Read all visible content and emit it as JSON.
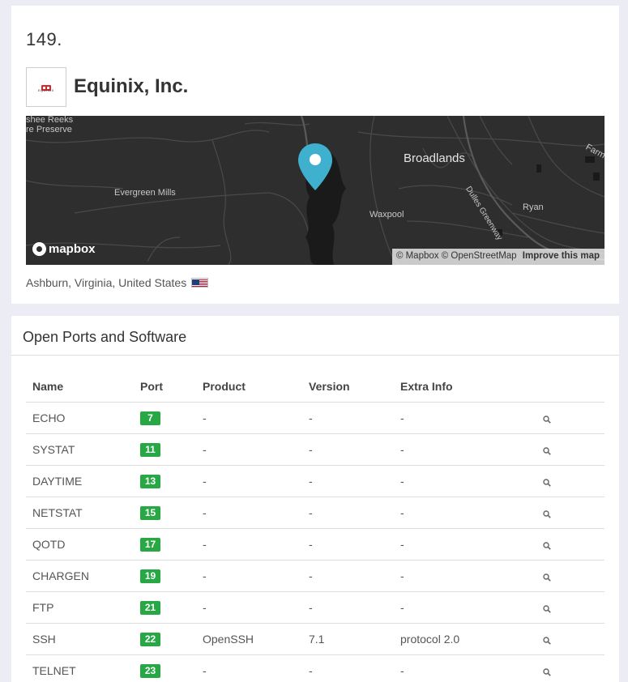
{
  "header": {
    "ip": "149.",
    "logo_text": "EQUINIX",
    "org_name": "Equinix, Inc.",
    "location": "Ashburn, Virginia, United States"
  },
  "map": {
    "labels": {
      "preserve_line1": "shee Reeks",
      "preserve_line2": "re Preserve",
      "evergreen": "Evergreen Mills",
      "broadlands": "Broadlands",
      "waxpool": "Waxpool",
      "ryan": "Ryan",
      "farm": "Farm",
      "dulles": "Dulles Greenway"
    },
    "brand": "mapbox",
    "attribution": "© Mapbox © OpenStreetMap",
    "improve": "Improve this map"
  },
  "ports_section": {
    "title": "Open Ports and Software",
    "columns": {
      "name": "Name",
      "port": "Port",
      "product": "Product",
      "version": "Version",
      "extra": "Extra Info"
    },
    "rows": [
      {
        "name": "ECHO",
        "port": "7",
        "product": "-",
        "version": "-",
        "extra": "-"
      },
      {
        "name": "SYSTAT",
        "port": "11",
        "product": "-",
        "version": "-",
        "extra": "-"
      },
      {
        "name": "DAYTIME",
        "port": "13",
        "product": "-",
        "version": "-",
        "extra": "-"
      },
      {
        "name": "NETSTAT",
        "port": "15",
        "product": "-",
        "version": "-",
        "extra": "-"
      },
      {
        "name": "QOTD",
        "port": "17",
        "product": "-",
        "version": "-",
        "extra": "-"
      },
      {
        "name": "CHARGEN",
        "port": "19",
        "product": "-",
        "version": "-",
        "extra": "-"
      },
      {
        "name": "FTP",
        "port": "21",
        "product": "-",
        "version": "-",
        "extra": "-"
      },
      {
        "name": "SSH",
        "port": "22",
        "product": "OpenSSH",
        "version": "7.1",
        "extra": "protocol 2.0"
      },
      {
        "name": "TELNET",
        "port": "23",
        "product": "-",
        "version": "-",
        "extra": "-"
      }
    ]
  },
  "colors": {
    "port_badge": "#28a745",
    "map_bg": "#2e2e2e",
    "pin": "#3fb1ce"
  },
  "icons": {
    "row_action": "search-icon",
    "location_pin": "map-pin-icon",
    "flag": "us-flag-icon"
  }
}
